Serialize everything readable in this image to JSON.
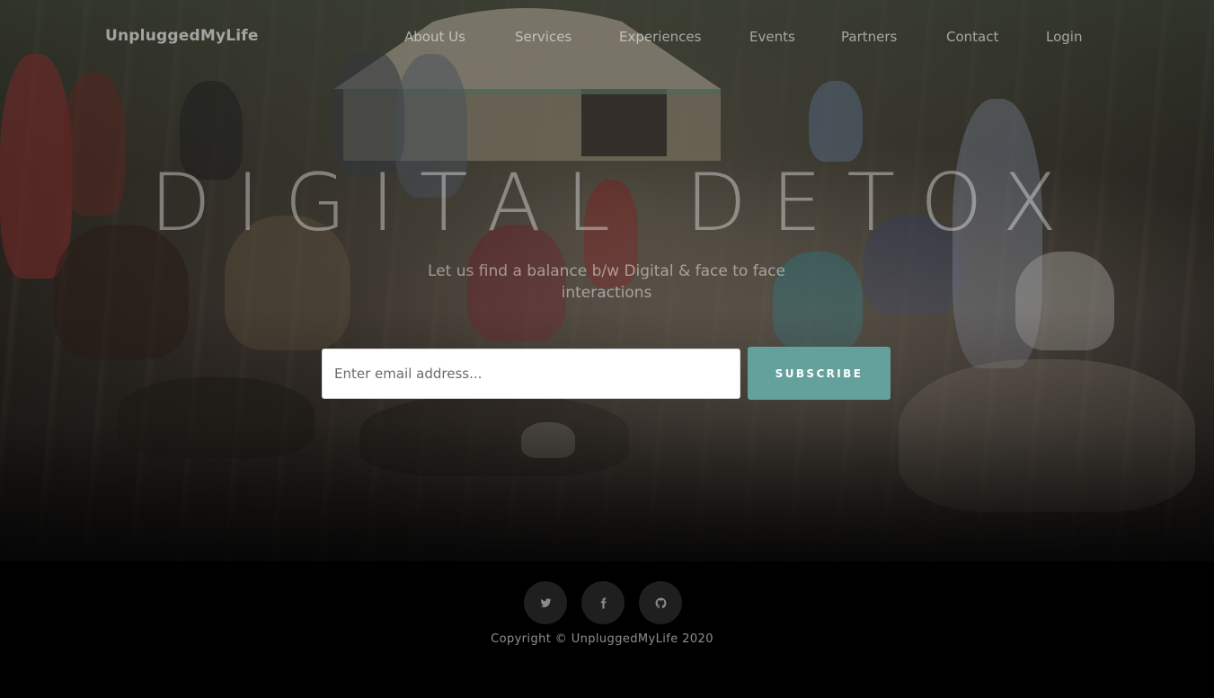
{
  "brand": "UnpluggedMyLife",
  "nav": {
    "items": [
      {
        "label": "About Us"
      },
      {
        "label": "Services"
      },
      {
        "label": "Experiences"
      },
      {
        "label": "Events"
      },
      {
        "label": "Partners"
      },
      {
        "label": "Contact"
      },
      {
        "label": "Login"
      }
    ]
  },
  "hero": {
    "title": "DIGITAL DETOX",
    "subtitle": "Let us find a balance b/w Digital & face to face interactions",
    "email_placeholder": "Enter email address...",
    "subscribe_label": "Subscribe"
  },
  "footer": {
    "social": [
      {
        "icon": "twitter-icon"
      },
      {
        "icon": "facebook-icon"
      },
      {
        "icon": "github-icon"
      }
    ],
    "copyright": "Copyright © UnpluggedMyLife 2020"
  },
  "colors": {
    "accent": "#64a19d",
    "footer_bg": "#000000",
    "social_bg": "#1f1f1f"
  }
}
